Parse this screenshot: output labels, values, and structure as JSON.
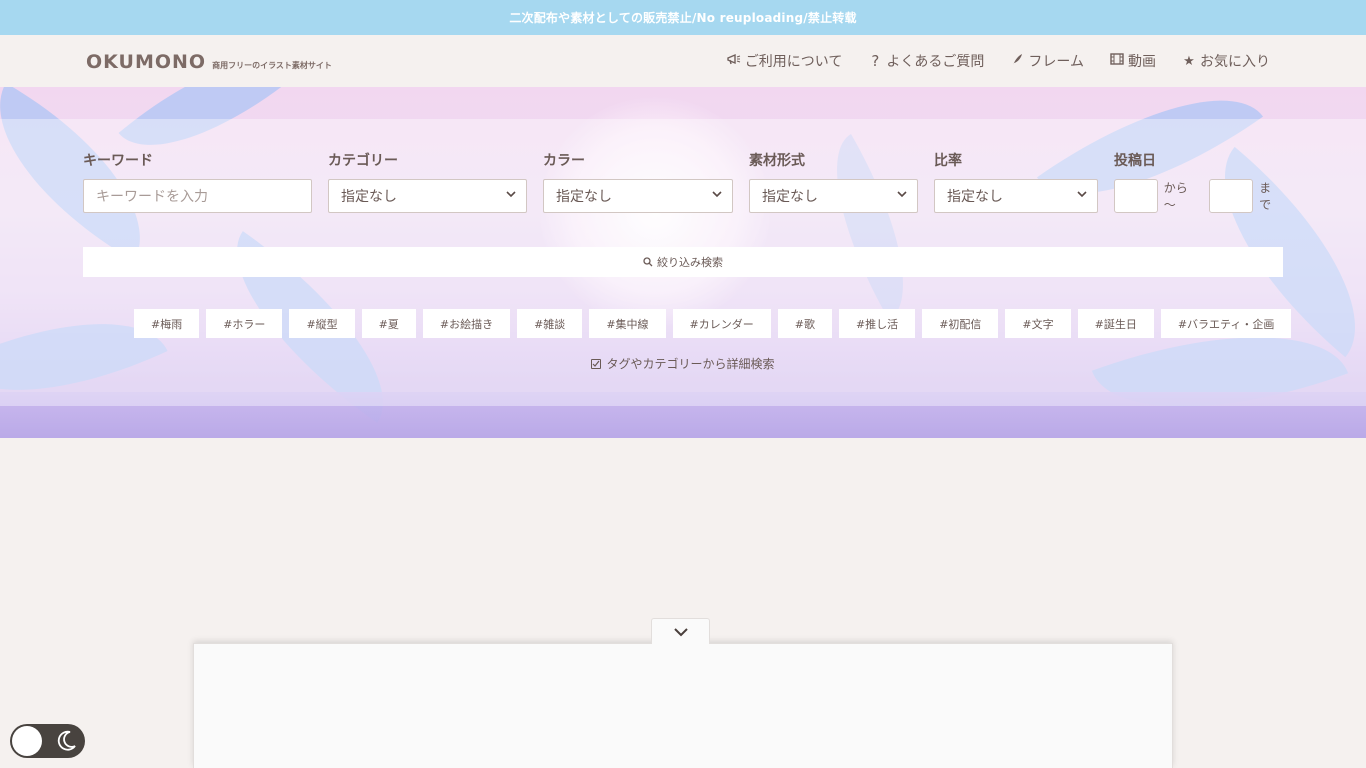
{
  "notice": "二次配布や素材としての販売禁止/No reuploading/禁止转载",
  "header": {
    "logo_main": "OKUMONO",
    "logo_sub": "商用フリーのイラスト素材サイト",
    "nav": [
      {
        "icon": "megaphone-icon",
        "label": "ご利用について"
      },
      {
        "icon": "question-icon",
        "label": "よくあるご質問"
      },
      {
        "icon": "feather-icon",
        "label": "フレーム"
      },
      {
        "icon": "film-icon",
        "label": "動画"
      },
      {
        "icon": "star-icon",
        "label": "お気に入り"
      }
    ]
  },
  "search": {
    "keyword_label": "キーワード",
    "keyword_placeholder": "キーワードを入力",
    "category_label": "カテゴリー",
    "category_value": "指定なし",
    "color_label": "カラー",
    "color_value": "指定なし",
    "format_label": "素材形式",
    "format_value": "指定なし",
    "ratio_label": "比率",
    "ratio_value": "指定なし",
    "date_label": "投稿日",
    "date_from_text": "から 〜",
    "date_to_text": "まで",
    "submit_label": "絞り込み検索"
  },
  "tags": [
    "#梅雨",
    "#ホラー",
    "#縦型",
    "#夏",
    "#お絵描き",
    "#雑談",
    "#集中線",
    "#カレンダー",
    "#歌",
    "#推し活",
    "#初配信",
    "#文字",
    "#誕生日",
    "#バラエティ・企画"
  ],
  "detail_search_label": "タグやカテゴリーから詳細検索",
  "colors": {
    "notice_bg": "#a6d8f0",
    "text": "#6a5a56",
    "page_bg": "#f5f1ef"
  }
}
